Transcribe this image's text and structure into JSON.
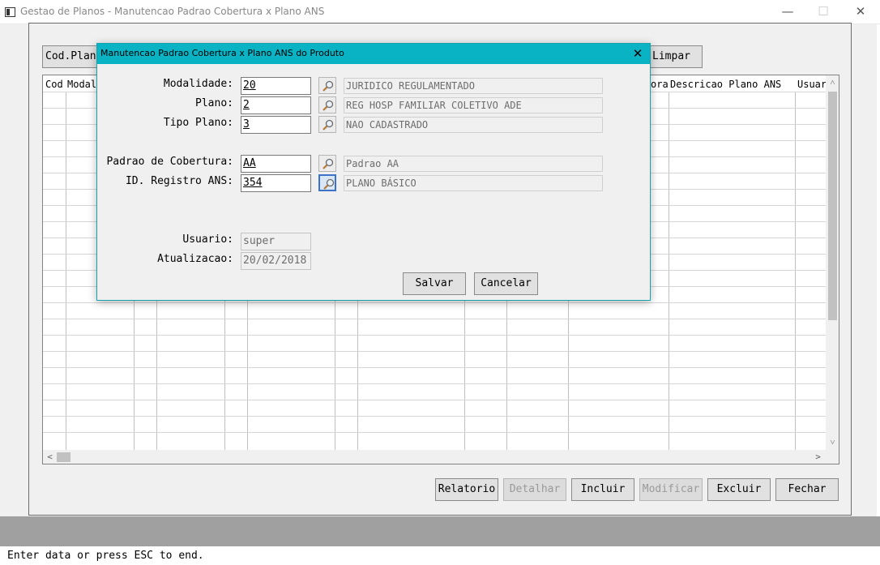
{
  "window": {
    "title": "Gestao de Planos - Manutencao Padrao Cobertura x Plano ANS",
    "minimize_glyph": "—",
    "maximize_glyph": "☐",
    "close_glyph": "✕"
  },
  "toolbar": {
    "cod_plano_label": "Cod.Plan",
    "limpar_label": "Limpar"
  },
  "grid": {
    "headers": [
      "Cod",
      "Modal",
      "ora",
      "Descricao Plano ANS",
      "Usuar"
    ]
  },
  "bottom_buttons": {
    "relatorio": "Relatorio",
    "detalhar": "Detalhar",
    "incluir": "Incluir",
    "modificar": "Modificar",
    "excluir": "Excluir",
    "fechar": "Fechar"
  },
  "status": {
    "text": "Enter data or press ESC to end."
  },
  "dialog": {
    "title": "Manutencao Padrao Cobertura x Plano ANS do Produto",
    "close_glyph": "✕",
    "fields": {
      "modalidade": {
        "label": "Modalidade:",
        "value": "20",
        "desc": "JURIDICO REGULAMENTADO"
      },
      "plano": {
        "label": "Plano:",
        "value": "2",
        "desc": "REG HOSP FAMILIAR COLETIVO ADE"
      },
      "tipo_plano": {
        "label": "Tipo Plano:",
        "value": "3",
        "desc": "NAO CADASTRADO"
      },
      "padrao": {
        "label": "Padrao de Cobertura:",
        "value": "AA",
        "desc": "Padrao AA"
      },
      "registro": {
        "label": "ID. Registro ANS:",
        "value": "354",
        "desc": "PLANO BÁSICO"
      },
      "usuario": {
        "label": "Usuario:",
        "value": "super"
      },
      "atualizacao": {
        "label": "Atualizacao:",
        "value": "20/02/2018"
      }
    },
    "buttons": {
      "salvar": "Salvar",
      "cancelar": "Cancelar"
    }
  },
  "colors": {
    "dialog_title_bg": "#09b3c4",
    "status_bar_bg": "#a0a0a0"
  }
}
